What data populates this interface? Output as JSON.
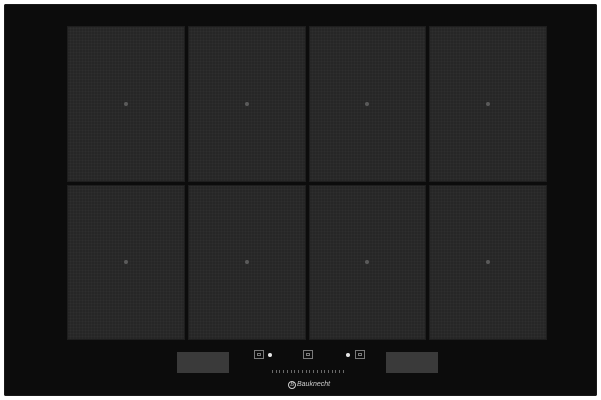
{
  "appliance": {
    "type": "induction hob",
    "surface_color": "#0c0c0c",
    "zone_color": "#262626"
  },
  "zones": [
    {
      "row": 1,
      "col": 1,
      "icon": "zone-center-dot"
    },
    {
      "row": 1,
      "col": 2,
      "icon": "zone-center-dot"
    },
    {
      "row": 1,
      "col": 3,
      "icon": "zone-center-dot"
    },
    {
      "row": 1,
      "col": 4,
      "icon": "zone-center-dot"
    },
    {
      "row": 2,
      "col": 1,
      "icon": "zone-center-dot"
    },
    {
      "row": 2,
      "col": 2,
      "icon": "zone-center-dot"
    },
    {
      "row": 2,
      "col": 3,
      "icon": "zone-center-dot"
    },
    {
      "row": 2,
      "col": 4,
      "icon": "zone-center-dot"
    }
  ],
  "control_panel": {
    "left_display": "",
    "right_display": "",
    "icons": [
      "left-zone-select-icon",
      "center-function-icon",
      "right-zone-select-icon"
    ],
    "slider_ticks": 20
  },
  "brand": {
    "logo_mark": "B",
    "name": "Bauknecht"
  }
}
